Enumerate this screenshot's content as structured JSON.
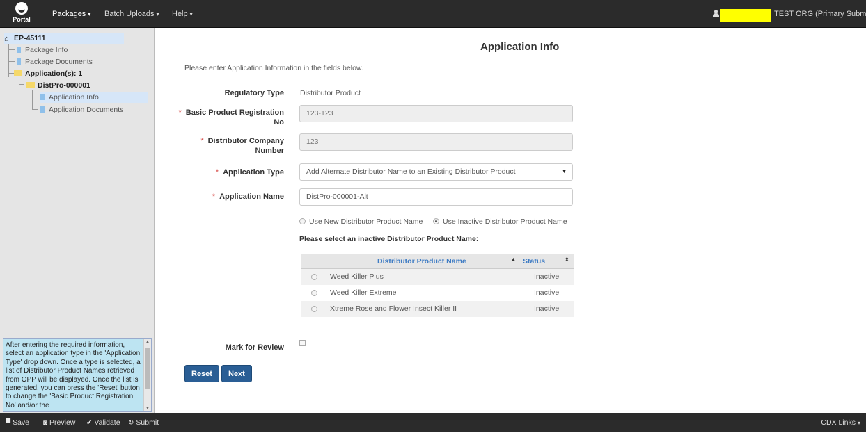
{
  "topbar": {
    "logo_text": "Portal",
    "menus": [
      {
        "label": "Packages"
      },
      {
        "label": "Batch Uploads"
      },
      {
        "label": "Help"
      }
    ],
    "org_label": "TEST ORG (Primary Submitter"
  },
  "tree": {
    "root": "EP-45111",
    "package_info": "Package Info",
    "package_documents": "Package Documents",
    "applications": "Application(s): 1",
    "app": "DistPro-000001",
    "app_info": "Application Info",
    "app_documents": "Application Documents"
  },
  "help_text": "After entering the required information, select an application type in the 'Application Type' drop down. Once a type is selected, a list of Distributor Product Names retrieved from OPP will be displayed. Once the list is generated, you can press the 'Reset' button to change the 'Basic Product Registration No' and/or the",
  "form": {
    "title": "Application Info",
    "intro": "Please enter Application Information in the fields below.",
    "regulatory_type_label": "Regulatory Type",
    "regulatory_type_value": "Distributor Product",
    "basic_reg_label_1": "Basic Product Registration",
    "basic_reg_label_2": "No",
    "basic_reg_value": "123-123",
    "dist_company_label_1": "Distributor Company",
    "dist_company_label_2": "Number",
    "dist_company_value": "123",
    "app_type_label": "Application Type",
    "app_type_value": "Add Alternate Distributor Name to an Existing Distributor Product",
    "app_name_label": "Application Name",
    "app_name_value": "DistPro-000001-Alt",
    "opt_new": "Use New Distributor Product Name",
    "opt_inactive": "Use Inactive Distributor Product Name",
    "select_prompt": "Please select an inactive Distributor Product Name:",
    "grid": {
      "col_name": "Distributor Product Name",
      "col_status": "Status",
      "rows": [
        {
          "name": "Weed Killer Plus",
          "status": "Inactive"
        },
        {
          "name": "Weed Killer Extreme",
          "status": "Inactive"
        },
        {
          "name": "Xtreme Rose and Flower Insect Killer II",
          "status": "Inactive"
        }
      ]
    },
    "mark_review_label": "Mark for Review",
    "reset_label": "Reset",
    "next_label": "Next"
  },
  "bottombar": {
    "save": "Save",
    "preview": "Preview",
    "validate": "Validate",
    "submit": "Submit",
    "cdx_links": "CDX Links"
  },
  "colors": {
    "navbar": "#2b2b2b",
    "sidebar": "#e5e5e5",
    "help_box": "#bde4f2",
    "button": "#2a5e95",
    "grid_header_text": "#3f7cc4",
    "required": "#d9534f",
    "redaction": "#ffff00"
  }
}
